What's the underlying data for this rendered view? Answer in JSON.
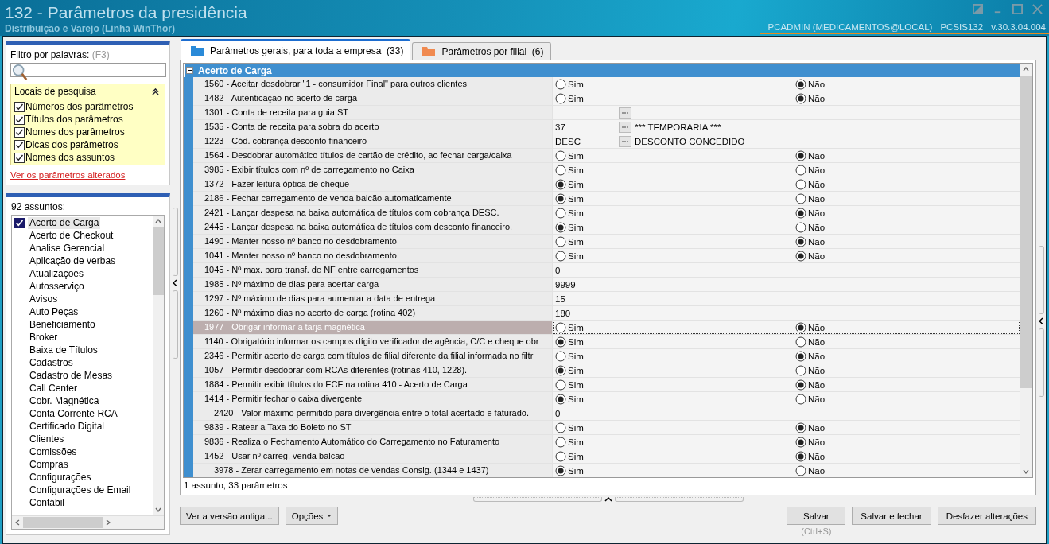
{
  "window": {
    "title": "132 - Parâmetros da presidência",
    "subtitle": "Distribuição e Varejo (Linha WinThor)",
    "user": "PCADMIN (MEDICAMENTOS@LOCAL)",
    "program": "PCSIS132",
    "version": "v.30.3.04.004"
  },
  "filter": {
    "label": "Filtro por palavras:",
    "shortcut": "(F3)",
    "search_locations": {
      "title": "Locais de pesquisa",
      "expanded": true,
      "options": [
        {
          "label": "Números dos parâmetros",
          "checked": true
        },
        {
          "label": "Títulos dos parâmetros",
          "checked": true
        },
        {
          "label": "Nomes dos parâmetros",
          "checked": true
        },
        {
          "label": "Dicas dos parâmetros",
          "checked": true
        },
        {
          "label": "Nomes dos assuntos",
          "checked": true
        }
      ]
    },
    "changed_link": "Ver os parâmetros alterados"
  },
  "subjects": {
    "count_label": "92 assuntos:",
    "items": [
      {
        "label": "Acerto de Carga",
        "checked": true,
        "selected": true
      },
      {
        "label": "Acerto de Checkout",
        "checked": false,
        "selected": false
      },
      {
        "label": "Analise Gerencial",
        "checked": false,
        "selected": false
      },
      {
        "label": "Aplicação de verbas",
        "checked": false,
        "selected": false
      },
      {
        "label": "Atualizações",
        "checked": false,
        "selected": false
      },
      {
        "label": "Autosserviço",
        "checked": false,
        "selected": false
      },
      {
        "label": "Avisos",
        "checked": false,
        "selected": false
      },
      {
        "label": "Auto Peças",
        "checked": false,
        "selected": false
      },
      {
        "label": "Beneficiamento",
        "checked": false,
        "selected": false
      },
      {
        "label": "Broker",
        "checked": false,
        "selected": false
      },
      {
        "label": "Baixa de Títulos",
        "checked": false,
        "selected": false
      },
      {
        "label": "Cadastros",
        "checked": false,
        "selected": false
      },
      {
        "label": "Cadastro de Mesas",
        "checked": false,
        "selected": false
      },
      {
        "label": "Call Center",
        "checked": false,
        "selected": false
      },
      {
        "label": "Cobr. Magnética",
        "checked": false,
        "selected": false
      },
      {
        "label": "Conta Corrente RCA",
        "checked": false,
        "selected": false
      },
      {
        "label": "Certificado Digital",
        "checked": false,
        "selected": false
      },
      {
        "label": "Clientes",
        "checked": false,
        "selected": false
      },
      {
        "label": "Comissões",
        "checked": false,
        "selected": false
      },
      {
        "label": "Compras",
        "checked": false,
        "selected": false
      },
      {
        "label": "Configurações",
        "checked": false,
        "selected": false
      },
      {
        "label": "Configurações de Email",
        "checked": false,
        "selected": false
      },
      {
        "label": "Contábil",
        "checked": false,
        "selected": false
      }
    ]
  },
  "tabs": [
    {
      "label": "Parâmetros gerais, para toda a empresa",
      "count": "(33)",
      "selected": true
    },
    {
      "label": "Parâmetros por filial",
      "count": "(6)",
      "selected": false
    }
  ],
  "grid": {
    "group": "Acerto de Carga",
    "expanded": true,
    "rows": [
      {
        "kind": "radio",
        "label": "1560 - Aceitar desdobrar \"1 - consumidor Final\" para outros clientes",
        "indented": false,
        "selected": false,
        "options": [
          {
            "label": "Sim",
            "selected": false
          },
          {
            "label": "Não",
            "selected": true
          }
        ]
      },
      {
        "kind": "radio",
        "label": "1482 - Autenticação no acerto de carga",
        "indented": false,
        "selected": false,
        "options": [
          {
            "label": "Sim",
            "selected": false
          },
          {
            "label": "Não",
            "selected": true
          }
        ]
      },
      {
        "kind": "lookup",
        "label": "1301 - Conta de receita para guia ST",
        "indented": false,
        "selected": false
      },
      {
        "kind": "lookup",
        "label": "1535 - Conta de receita para sobra do acerto",
        "value": "37",
        "description": "*** TEMPORARIA ***",
        "indented": false,
        "selected": false
      },
      {
        "kind": "lookup",
        "label": "1223 - Cód. cobrança desconto financeiro",
        "value": "DESC",
        "description": "DESCONTO CONCEDIDO",
        "indented": false,
        "selected": false
      },
      {
        "kind": "radio",
        "label": "1564 - Desdobrar automático títulos de cartão de crédito, ao fechar carga/caixa",
        "indented": false,
        "selected": false,
        "options": [
          {
            "label": "Sim",
            "selected": false
          },
          {
            "label": "Não",
            "selected": true
          }
        ]
      },
      {
        "kind": "radio",
        "label": "3985 - Exibir títulos com nº de carregamento no Caixa",
        "indented": false,
        "selected": false,
        "options": [
          {
            "label": "Sim",
            "selected": false
          },
          {
            "label": "Não",
            "selected": false
          }
        ]
      },
      {
        "kind": "radio",
        "label": "1372 - Fazer leitura óptica de cheque",
        "indented": false,
        "selected": false,
        "options": [
          {
            "label": "Sim",
            "selected": true
          },
          {
            "label": "Não",
            "selected": false
          }
        ]
      },
      {
        "kind": "radio",
        "label": "2186 - Fechar carregamento de venda balcão automaticamente",
        "indented": false,
        "selected": false,
        "options": [
          {
            "label": "Sim",
            "selected": true
          },
          {
            "label": "Não",
            "selected": false
          }
        ]
      },
      {
        "kind": "radio",
        "label": "2421 - Lançar despesa na baixa automática de títulos com cobrança DESC.",
        "indented": false,
        "selected": false,
        "options": [
          {
            "label": "Sim",
            "selected": false
          },
          {
            "label": "Não",
            "selected": true
          }
        ]
      },
      {
        "kind": "radio",
        "label": "2445 - Lançar despesa na baixa automática de títulos com desconto financeiro.",
        "indented": false,
        "selected": false,
        "options": [
          {
            "label": "Sim",
            "selected": true
          },
          {
            "label": "Não",
            "selected": false
          }
        ]
      },
      {
        "kind": "radio",
        "label": "1490 - Manter nosso nº banco no desdobramento",
        "indented": false,
        "selected": false,
        "options": [
          {
            "label": "Sim",
            "selected": false
          },
          {
            "label": "Não",
            "selected": true
          }
        ]
      },
      {
        "kind": "radio",
        "label": "1041 - Manter nosso nº banco no desdobramento",
        "indented": false,
        "selected": false,
        "options": [
          {
            "label": "Sim",
            "selected": false
          },
          {
            "label": "Não",
            "selected": true
          }
        ]
      },
      {
        "kind": "text",
        "label": "1045 - Nº max. para transf. de NF entre carregamentos",
        "value": "0",
        "indented": false,
        "selected": false
      },
      {
        "kind": "text",
        "label": "1985 - Nº máximo de dias para acertar carga",
        "value": "9999",
        "indented": false,
        "selected": false
      },
      {
        "kind": "text",
        "label": "1297 - Nº máximo de dias para aumentar a data de entrega",
        "value": "15",
        "indented": false,
        "selected": false
      },
      {
        "kind": "text",
        "label": "1260 - Nº máximo dias no acerto de carga (rotina 402)",
        "value": "180",
        "indented": false,
        "selected": false
      },
      {
        "kind": "radio",
        "label": "1977 - Obrigar informar a tarja magnética",
        "indented": false,
        "selected": true,
        "options": [
          {
            "label": "Sim",
            "selected": false
          },
          {
            "label": "Não",
            "selected": true
          }
        ]
      },
      {
        "kind": "radio",
        "label": "1140 - Obrigatório informar os campos dígito verificador de agência, C/C e cheque obr",
        "indented": false,
        "selected": false,
        "options": [
          {
            "label": "Sim",
            "selected": true
          },
          {
            "label": "Não",
            "selected": false
          }
        ]
      },
      {
        "kind": "radio",
        "label": "2346 - Permitir acerto de carga com títulos de filial diferente da filial informada no filtr",
        "indented": false,
        "selected": false,
        "options": [
          {
            "label": "Sim",
            "selected": false
          },
          {
            "label": "Não",
            "selected": true
          }
        ]
      },
      {
        "kind": "radio",
        "label": "1057 - Permitir desdobrar com RCAs diferentes (rotinas 410, 1228).",
        "indented": false,
        "selected": false,
        "options": [
          {
            "label": "Sim",
            "selected": true
          },
          {
            "label": "Não",
            "selected": false
          }
        ]
      },
      {
        "kind": "radio",
        "label": "1884 - Permitir exibir títulos do ECF na rotina 410 - Acerto de Carga",
        "indented": false,
        "selected": false,
        "options": [
          {
            "label": "Sim",
            "selected": false
          },
          {
            "label": "Não",
            "selected": true
          }
        ]
      },
      {
        "kind": "radio",
        "label": "1414 - Permitir fechar o caixa divergente",
        "indented": false,
        "selected": false,
        "options": [
          {
            "label": "Sim",
            "selected": true
          },
          {
            "label": "Não",
            "selected": false
          }
        ]
      },
      {
        "kind": "text",
        "label": "2420 - Valor máximo permitido para divergência entre o total acertado e faturado.",
        "value": "0",
        "indented": true,
        "selected": false
      },
      {
        "kind": "radio",
        "label": "9839 - Ratear a Taxa do Boleto no ST",
        "indented": false,
        "selected": false,
        "options": [
          {
            "label": "Sim",
            "selected": false
          },
          {
            "label": "Não",
            "selected": true
          }
        ]
      },
      {
        "kind": "radio",
        "label": "9836 - Realiza o Fechamento Automático do Carregamento no Faturamento",
        "indented": false,
        "selected": false,
        "options": [
          {
            "label": "Sim",
            "selected": false
          },
          {
            "label": "Não",
            "selected": true
          }
        ]
      },
      {
        "kind": "radio",
        "label": "1452 - Usar nº carreg. venda balcão",
        "indented": false,
        "selected": false,
        "options": [
          {
            "label": "Sim",
            "selected": false
          },
          {
            "label": "Não",
            "selected": true
          }
        ]
      },
      {
        "kind": "radio",
        "label": "3978 - Zerar carregamento em notas de vendas Consig. (1344 e 1437)",
        "indented": true,
        "selected": false,
        "options": [
          {
            "label": "Sim",
            "selected": true
          },
          {
            "label": "Não",
            "selected": false
          }
        ]
      }
    ]
  },
  "status": "1 assunto, 33 parâmetros",
  "buttons_left": [
    {
      "label": "Ver a versão antiga...",
      "kind": "plain"
    },
    {
      "label": "Opções",
      "kind": "menu"
    }
  ],
  "buttons_right": [
    {
      "label": "Salvar",
      "hint": "(Ctrl+S)"
    },
    {
      "label": "Salvar e fechar"
    },
    {
      "label": "Desfazer alterações"
    }
  ]
}
